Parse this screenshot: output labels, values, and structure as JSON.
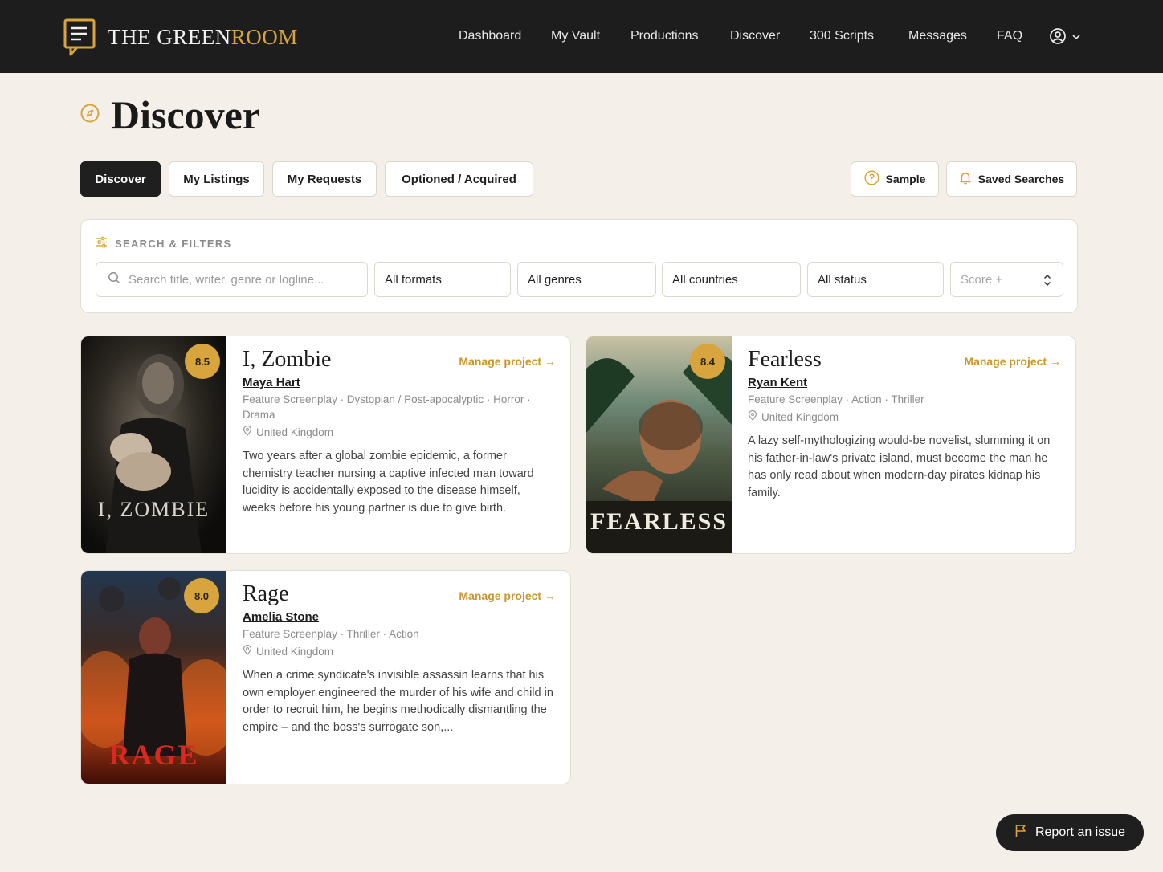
{
  "header": {
    "logo_text_main": "THE GREEN",
    "logo_text_accent": "ROOM",
    "nav": [
      {
        "label": "Dashboard"
      },
      {
        "label": "My Vault"
      },
      {
        "label": "Productions"
      },
      {
        "label": "Discover"
      },
      {
        "label": "300 Scripts"
      },
      {
        "label": "Messages"
      },
      {
        "label": "FAQ"
      }
    ],
    "user_icon": "user-circle-icon"
  },
  "page": {
    "title": "Discover",
    "title_icon": "compass-icon"
  },
  "tabs": [
    {
      "label": "Discover",
      "active": true
    },
    {
      "label": "My Listings",
      "active": false
    },
    {
      "label": "My Requests",
      "active": false
    },
    {
      "label": "Optioned / Acquired",
      "active": false
    }
  ],
  "tools": {
    "sample_label": "Sample",
    "saved_searches_label": "Saved Searches"
  },
  "filters": {
    "section_label": "SEARCH & FILTERS",
    "search_placeholder": "Search title, writer, genre or logline...",
    "format": "All formats",
    "genre": "All genres",
    "country": "All countries",
    "status": "All status",
    "score_placeholder": "Score +"
  },
  "projects": [
    {
      "title": "I, Zombie",
      "score": "8.5",
      "manage_label": "Manage project →",
      "writer": "Maya Hart",
      "meta": "Feature Screenplay · Dystopian / Post-apocalyptic · Horror · Drama",
      "location": "United Kingdom",
      "logline": "Two years after a global zombie epidemic, a former chemistry teacher nursing a captive infected man toward lucidity is accidentally exposed to the disease himself, weeks before his young partner is due to give birth.",
      "poster_text": "I, ZOMBIE"
    },
    {
      "title": "Fearless",
      "score": "8.4",
      "manage_label": "Manage project →",
      "writer": "Ryan Kent",
      "meta": "Feature Screenplay · Action · Thriller",
      "location": "United Kingdom",
      "logline": "A lazy self-mythologizing would-be novelist, slumming it on his father-in-law's private island, must become the man he has only read about when modern-day pirates kidnap his family.",
      "poster_text": "FEARLESS"
    },
    {
      "title": "Rage",
      "score": "8.0",
      "manage_label": "Manage project →",
      "writer": "Amelia Stone",
      "meta": "Feature Screenplay · Thriller · Action",
      "location": "United Kingdom",
      "logline": "When a crime syndicate's invisible assassin learns that his own employer engineered the murder of his wife and child in order to recruit him, he begins methodically dismantling the empire – and the boss's surrogate son,...",
      "poster_text": "RAGE"
    }
  ],
  "report_label": "Report an issue",
  "colors": {
    "accent": "#d7a43d",
    "topbar": "#1d1d1d",
    "background": "#f4f0e9"
  }
}
